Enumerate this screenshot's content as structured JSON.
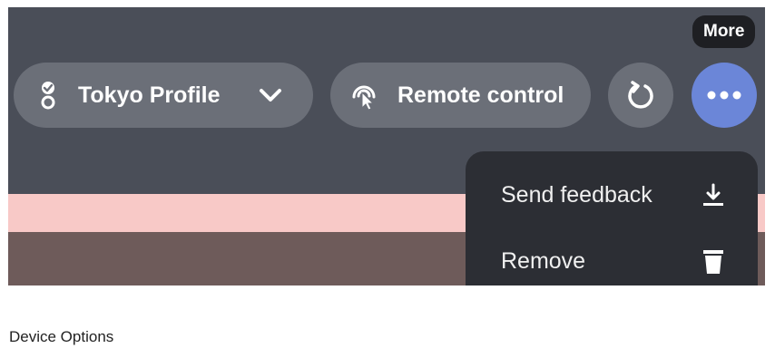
{
  "toolbar": {
    "profile_label": "Tokyo Profile",
    "remote_label": "Remote control",
    "more_tooltip": "More"
  },
  "menu": {
    "items": [
      {
        "label": "Send feedback",
        "icon": "download-icon"
      },
      {
        "label": "Remove",
        "icon": "trash-icon"
      }
    ]
  },
  "caption": "Device Options",
  "colors": {
    "background": "#4a4e58",
    "pill": "#6b6f78",
    "accent": "#6b86d8",
    "menu": "#2c2e34",
    "band_pink": "#f8c9c7",
    "band_brown": "#6e5b5a"
  }
}
